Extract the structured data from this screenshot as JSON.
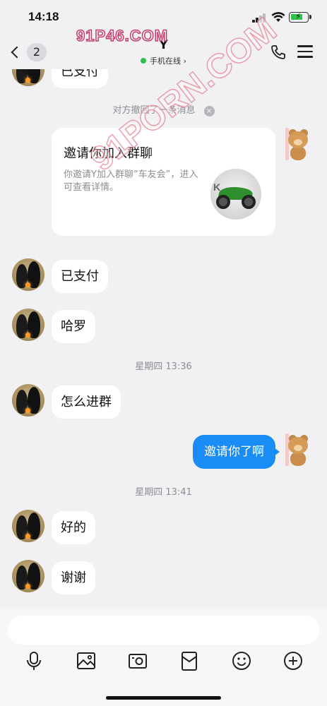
{
  "status": {
    "time": "14:18"
  },
  "header": {
    "unread_count": "2",
    "contact_name": "Y",
    "online_text": "手机在线",
    "online_chevron": "›"
  },
  "watermark": {
    "top": "91P46.COM",
    "diagonal": "91PORN.COM"
  },
  "messages": {
    "top_partial": "已支付",
    "recall_notice": "对方撤回了一条消息",
    "recall_close": "×",
    "invite": {
      "title": "邀请你加入群聊",
      "desc": "你邀请Y加入群聊“车友会”，进入可查看详情。",
      "thumb_text": "K"
    },
    "paid": "已支付",
    "hello": "哈罗",
    "time_1": "星期四 13:36",
    "how_join": "怎么进群",
    "invited_you": "邀请你了啊",
    "time_2": "星期四 13:41",
    "ok": "好的",
    "thanks": "谢谢"
  },
  "input": {
    "placeholder": ""
  },
  "icons": [
    "mic-icon",
    "image-icon",
    "camera-icon",
    "red-packet-icon",
    "emoji-icon",
    "plus-icon"
  ],
  "colors": {
    "accent": "#1a8cf5",
    "online": "#2ec24a",
    "background": "#f1f1f3"
  }
}
